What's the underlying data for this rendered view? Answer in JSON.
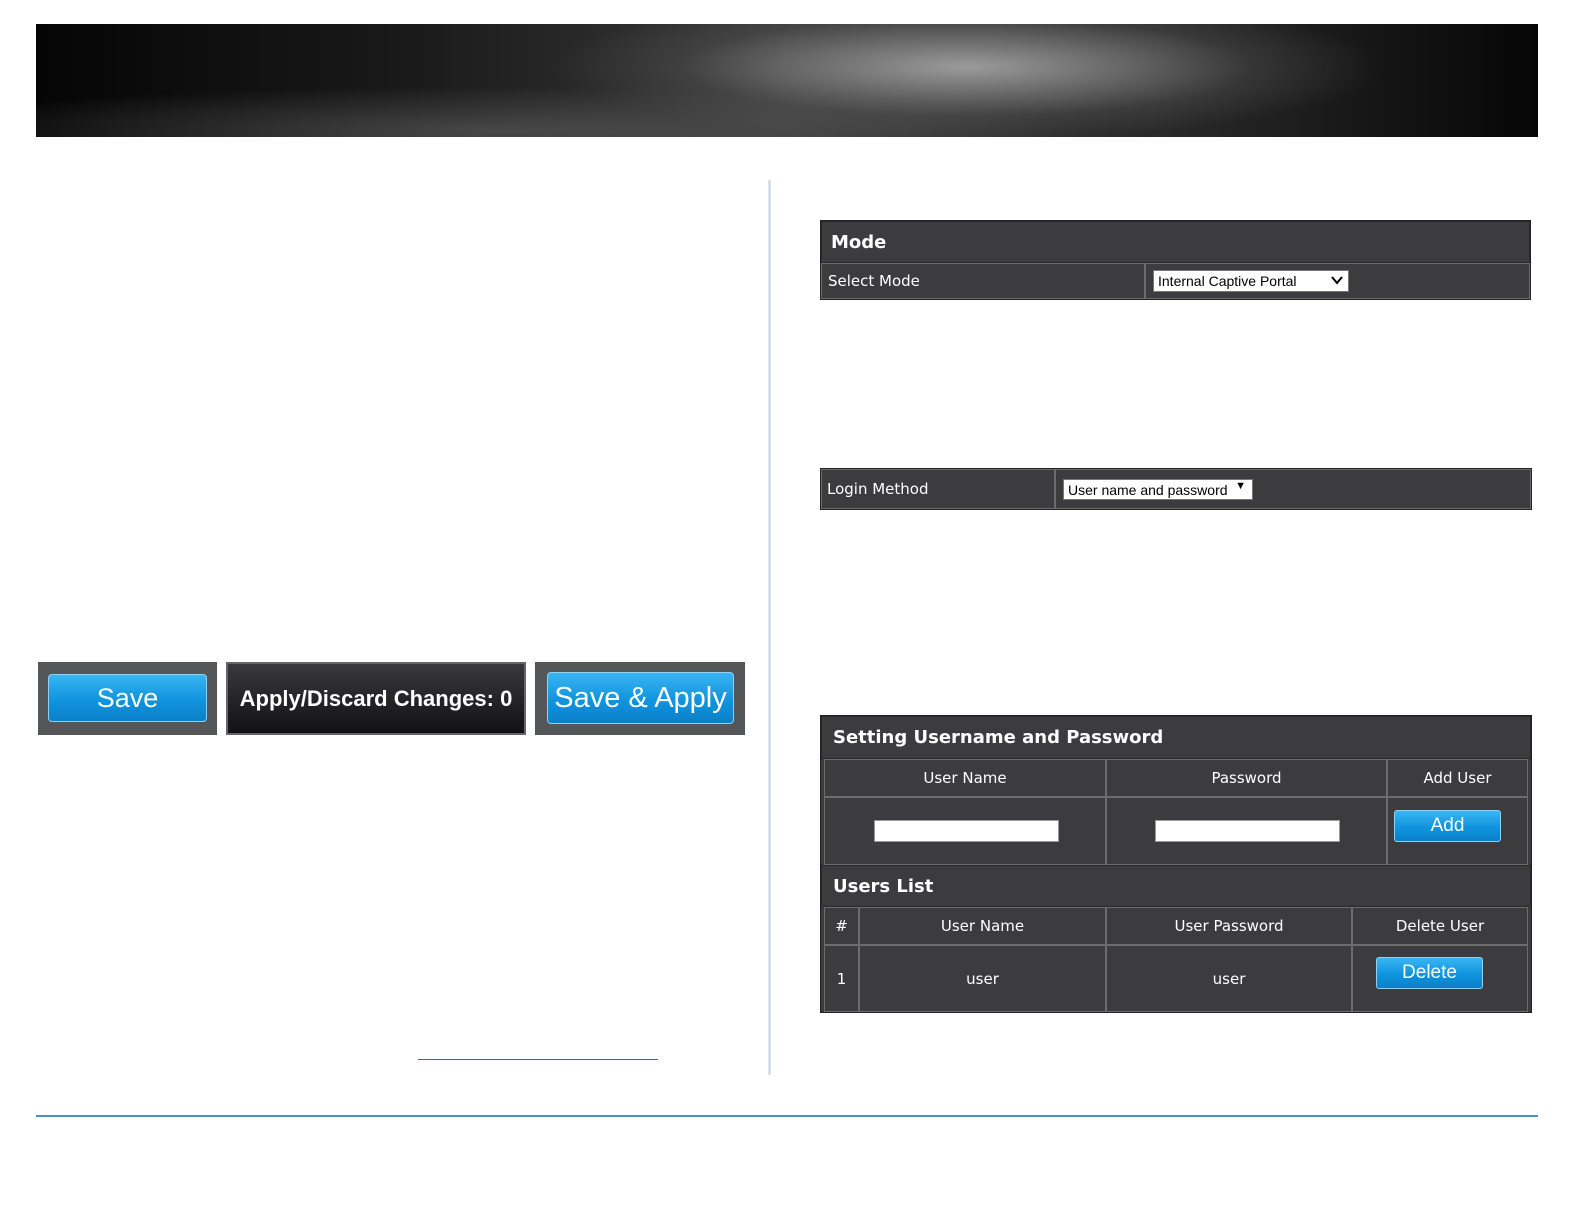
{
  "actions": {
    "save_label": "Save",
    "apply_discard_label": "Apply/Discard Changes: 0",
    "save_apply_label": "Save & Apply"
  },
  "mode_panel": {
    "title": "Mode",
    "select_mode_label": "Select Mode",
    "select_mode_value": "Internal Captive Portal"
  },
  "login_panel": {
    "label": "Login Method",
    "value": "User name and password"
  },
  "user_panel": {
    "title": "Setting Username and Password",
    "col_user_name": "User Name",
    "col_password": "Password",
    "col_add_user": "Add User",
    "add_button": "Add",
    "list_title": "Users List",
    "list_headers": {
      "index": "#",
      "user_name": "User Name",
      "user_password": "User Password",
      "delete_user": "Delete User"
    },
    "rows": [
      {
        "index": "1",
        "user_name": "user",
        "user_password": "user",
        "delete_label": "Delete"
      }
    ]
  },
  "colors": {
    "panel_bg": "#3c3c3e",
    "button_blue": "#1094de",
    "footer_line": "#4a90c8"
  }
}
